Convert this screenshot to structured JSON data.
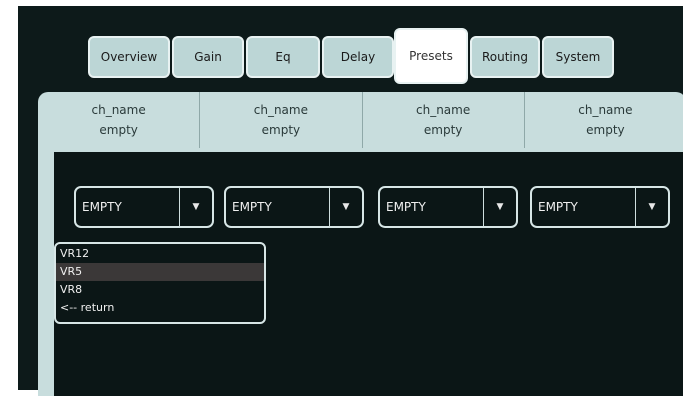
{
  "tabs": [
    {
      "label": "Overview",
      "active": false
    },
    {
      "label": "Gain",
      "active": false
    },
    {
      "label": "Eq",
      "active": false
    },
    {
      "label": "Delay",
      "active": false
    },
    {
      "label": "Presets",
      "active": true
    },
    {
      "label": "Routing",
      "active": false
    },
    {
      "label": "System",
      "active": false
    }
  ],
  "channels": [
    {
      "name": "ch_name",
      "status": "empty"
    },
    {
      "name": "ch_name",
      "status": "empty"
    },
    {
      "name": "ch_name",
      "status": "empty"
    },
    {
      "name": "ch_name",
      "status": "empty"
    }
  ],
  "preset_selects": [
    {
      "value": "EMPTY"
    },
    {
      "value": "EMPTY"
    },
    {
      "value": "EMPTY"
    },
    {
      "value": "EMPTY"
    }
  ],
  "dropdown": {
    "options": [
      "VR12",
      "VR5",
      "VR8",
      "<-- return"
    ],
    "highlighted": "VR5"
  },
  "icons": {
    "select_arrow": "chevron-down-icon"
  },
  "colors": {
    "background": "#0b1616",
    "tab": "#bcd6d6",
    "panel": "#c8dddd",
    "highlight": "#3b3838"
  }
}
